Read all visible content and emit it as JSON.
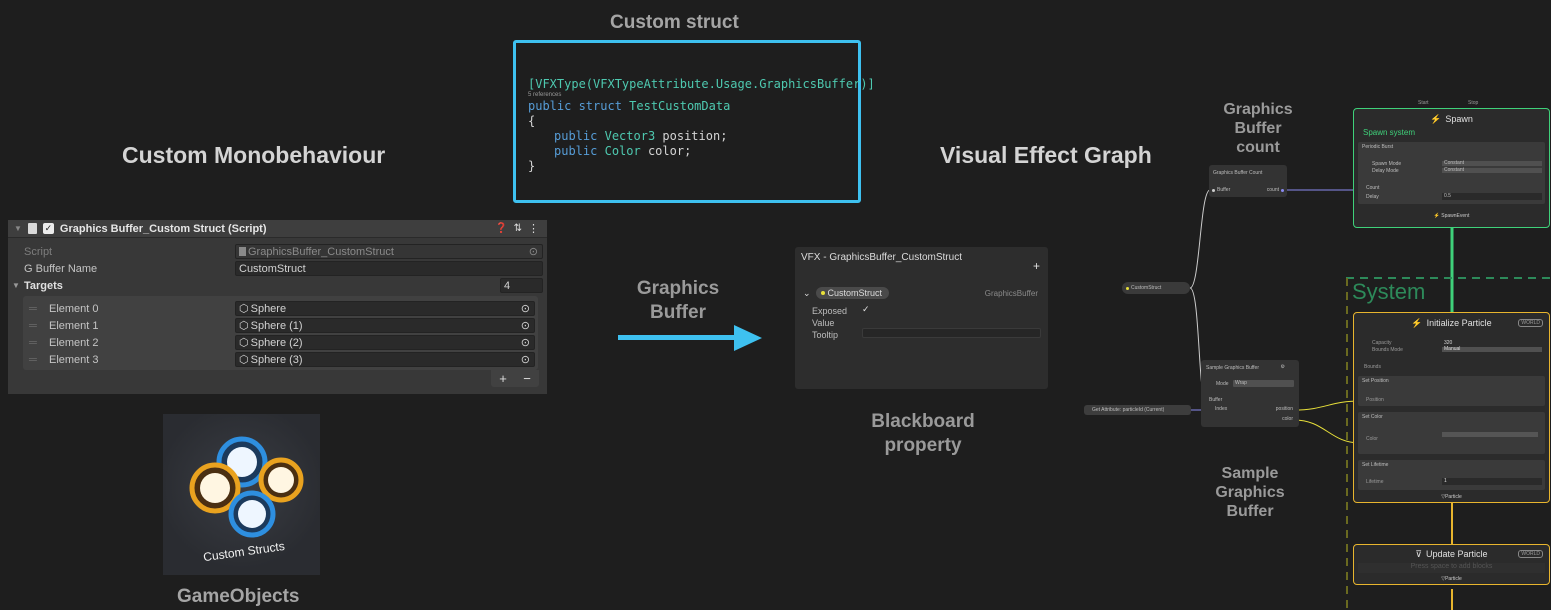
{
  "headings": {
    "custom_struct": "Custom struct",
    "custom_monobehaviour": "Custom Monobehaviour",
    "visual_effect_graph": "Visual Effect Graph",
    "graphics_buffer_arrow_label": [
      "Graphics",
      "Buffer"
    ],
    "blackboard_property": [
      "Blackboard",
      "property"
    ],
    "gameobjects": "GameObjects",
    "graphics_buffer_count": [
      "Graphics",
      "Buffer",
      "count"
    ],
    "sample_graphics_buffer": [
      "Sample",
      "Graphics",
      "Buffer"
    ]
  },
  "code": {
    "line1": "[VFXType(VFXTypeAttribute.Usage.GraphicsBuffer)]",
    "references": "5 references",
    "line2_kw": "public struct",
    "line2_name": "TestCustomData",
    "open_brace": "{",
    "field1_kw": "public",
    "field1_type": "Vector3",
    "field1_name": "position;",
    "field2_kw": "public",
    "field2_type": "Color",
    "field2_name": "color;",
    "close_brace": "}"
  },
  "inspector": {
    "title": "Graphics Buffer_Custom Struct (Script)",
    "script_label": "Script",
    "script_value": "GraphicsBuffer_CustomStruct",
    "gbuffer_label": "G Buffer Name",
    "gbuffer_value": "CustomStruct",
    "targets_label": "Targets",
    "targets_count": "4",
    "elements": [
      {
        "label": "Element 0",
        "value": "Sphere"
      },
      {
        "label": "Element 1",
        "value": "Sphere (1)"
      },
      {
        "label": "Element 2",
        "value": "Sphere (2)"
      },
      {
        "label": "Element 3",
        "value": "Sphere (3)"
      }
    ],
    "plus": "+",
    "minus": "−"
  },
  "thumbnail": {
    "caption": "Custom Structs"
  },
  "blackboard": {
    "title": "VFX - GraphicsBuffer_CustomStruct",
    "add": "+",
    "property_name": "CustomStruct",
    "property_type": "GraphicsBuffer",
    "exposed_label": "Exposed",
    "exposed_check": "✓",
    "value_label": "Value",
    "tooltip_label": "Tooltip"
  },
  "vfx": {
    "gb_count_title": "Graphics Buffer Count",
    "gb_count_in": "Buffer",
    "gb_count_out": "count",
    "customstruct_pill": "CustomStruct",
    "get_attribute": "Get Attribute: particleId (Current)",
    "sample_title": "Sample Graphics Buffer",
    "sample_mode_label": "Mode",
    "sample_mode_value": "Wrap",
    "sample_buffer": "Buffer",
    "sample_index": "Index",
    "sample_position": "position",
    "sample_color": "color",
    "spawn": {
      "start": "Start",
      "stop": "Stop",
      "title": "Spawn",
      "system_label": "Spawn system",
      "burst": "Periodic Burst",
      "spawn_mode_label": "Spawn Mode",
      "spawn_mode_value": "Constant",
      "delay_mode_label": "Delay Mode",
      "delay_mode_value": "Constant",
      "count_label": "Count",
      "delay_label": "Delay",
      "delay_value": "0.5",
      "event": "SpawnEvent"
    },
    "system_label": "System",
    "init": {
      "title": "Initialize Particle",
      "badge": "WORLD",
      "capacity_label": "Capacity",
      "capacity_value": "320",
      "bounds_mode_label": "Bounds Mode",
      "bounds_mode_value": "Manual",
      "bounds_label": "Bounds",
      "set_position": "Set Position",
      "position_label": "Position",
      "set_color": "Set Color",
      "color_label": "Color",
      "set_lifetime": "Set Lifetime",
      "lifetime_label": "Lifetime",
      "lifetime_value": "1",
      "footer": "Particle"
    },
    "update": {
      "title": "Update Particle",
      "badge": "WORLD",
      "hint": "Press space to add blocks",
      "footer": "Particle"
    }
  },
  "colors": {
    "accent_blue": "#3ec1f0",
    "spawn_green": "#3fd17a",
    "particle_yellow": "#e8b52e",
    "system_green_dashed": "#2d8a5a"
  }
}
